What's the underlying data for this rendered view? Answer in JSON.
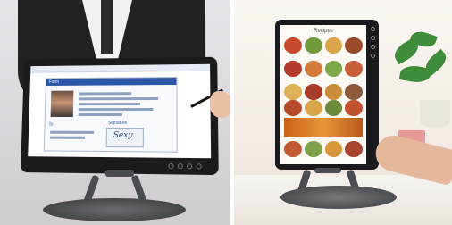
{
  "left_photo": {
    "screen": {
      "card_heading": "Form",
      "section_label": "To",
      "signature_heading": "Signature",
      "signature_text": "Sexy"
    }
  },
  "right_photo": {
    "screen": {
      "page_heading": "Recipes"
    }
  },
  "colors": {
    "stand": "#4b4c52",
    "bezel": "#1b1b1d",
    "form_accent": "#2b58a6"
  }
}
